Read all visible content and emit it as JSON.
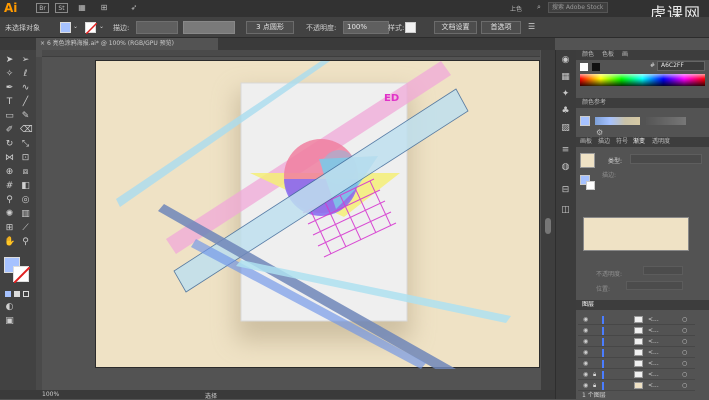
{
  "app": {
    "logo": "Ai",
    "bridge": "Br",
    "stock": "St",
    "workspace": "上色",
    "search_placeholder": "搜索 Adobe Stock",
    "watermark": "虎课网"
  },
  "control": {
    "selection": "未选择对象",
    "stroke_label": "描边:",
    "stroke_value": "",
    "profile": "3 点圆形",
    "opacity_label": "不透明度:",
    "opacity_value": "100%",
    "style_label": "样式:",
    "doc_setup": "文档设置",
    "preferences": "首选项"
  },
  "document": {
    "tab": "6 亮色涂鸦海报.ai* @ 100% (RGB/GPU 预览)"
  },
  "poster": {
    "badge": "ED"
  },
  "status": {
    "zoom": "100%",
    "tool": "选择"
  },
  "panels": {
    "color": {
      "tabs": [
        "颜色",
        "色板",
        "画"
      ],
      "hex": "A6C2FF"
    },
    "color_guide": {
      "title": "颜色参考"
    },
    "appearance": {
      "tabs": [
        "画板",
        "描边",
        "符号",
        "渐变",
        "透明度"
      ],
      "type_label": "类型:",
      "stroke_label": "描边:",
      "opacity_label": "不透明度:",
      "position_label": "位置:"
    },
    "layers": {
      "title": "图层",
      "footer": "1 个图层",
      "items": [
        "<...",
        "<...",
        "<...",
        "<...",
        "<...",
        "<...",
        "<..."
      ]
    }
  },
  "colors": {
    "artboard": "#efe2c5",
    "poster": "#efefef",
    "fill_swatch": "#a6c2ff",
    "accent": "#ff9a00"
  }
}
